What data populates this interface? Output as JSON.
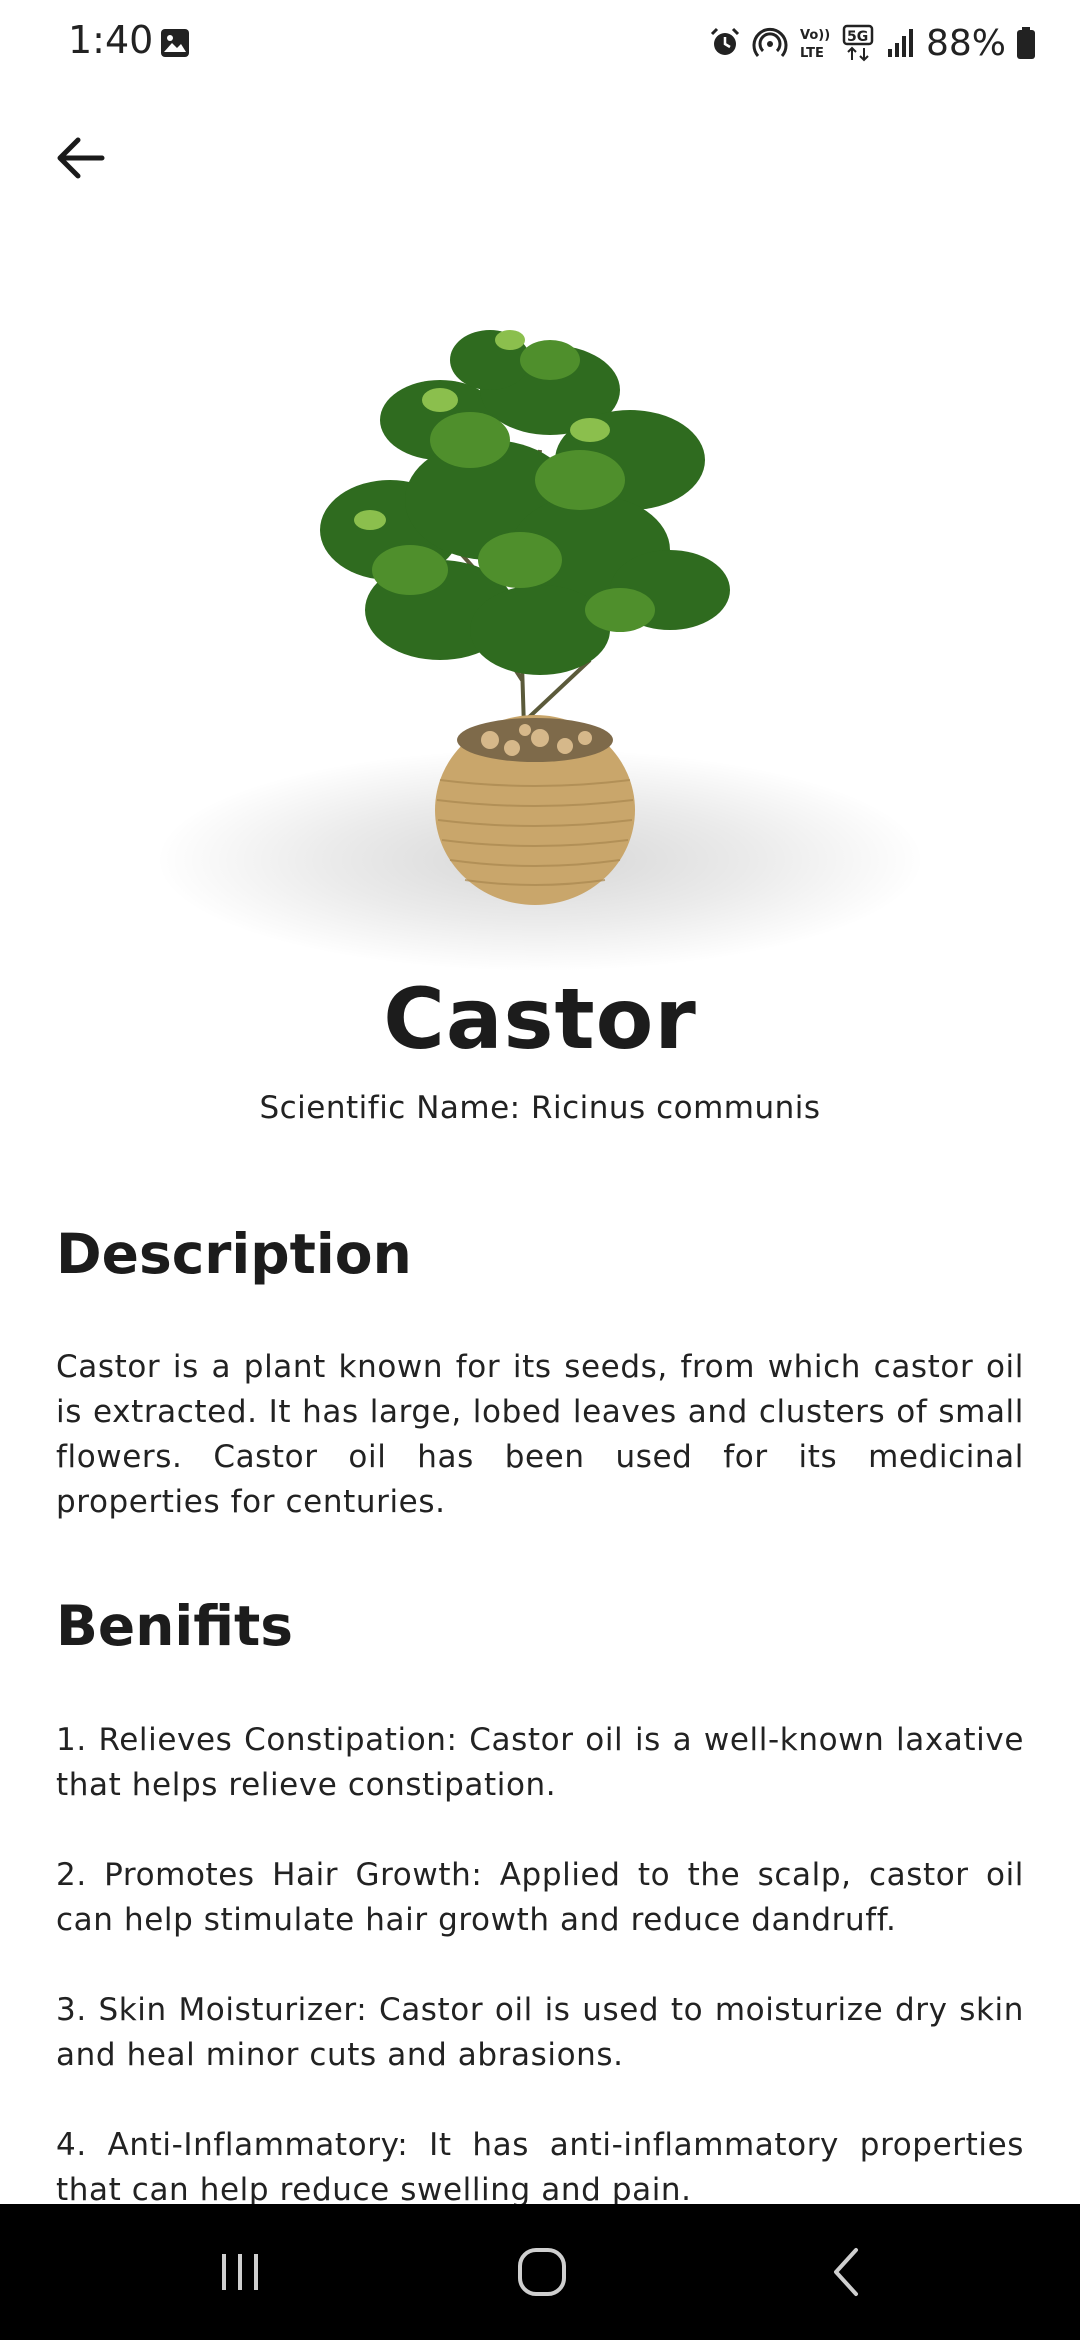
{
  "status_bar": {
    "time": "1:40",
    "battery": "88%",
    "icons": [
      "gallery-icon",
      "alarm-icon",
      "hotspot-icon",
      "volte-icon",
      "5g-icon",
      "signal-icon",
      "battery-icon"
    ]
  },
  "header": {
    "back_icon": "arrow-left-icon"
  },
  "plant": {
    "name": "Castor",
    "scientific_name": "Scientific Name: Ricinus communis",
    "image_icon": "potted-plant-image"
  },
  "description": {
    "heading": "Description",
    "text": "Castor is a plant known for its seeds, from which castor oil is extracted. It has large, lobed leaves and clusters of small flowers. Castor oil has been used for its medicinal properties for centuries."
  },
  "benefits": {
    "heading": "Benifits",
    "items": [
      "1. Relieves Constipation: Castor oil is a well-known laxative that helps relieve constipation.",
      "2. Promotes Hair Growth: Applied to the scalp, castor oil can help stimulate hair growth and reduce dandruff.",
      "3. Skin Moisturizer: Castor oil is used to moisturize dry skin and heal minor cuts and abrasions.",
      "4. Anti-Inflammatory: It has anti-inflammatory properties that can help reduce swelling and pain."
    ]
  },
  "nav_bar": {
    "icons": [
      "recents-icon",
      "home-icon",
      "back-icon"
    ]
  },
  "colors": {
    "text": "#1c1c1c",
    "background": "#ffffff",
    "nav_bar": "#000000",
    "leaf_green": "#2f6b1f",
    "pot_tan": "#c9a66b"
  }
}
